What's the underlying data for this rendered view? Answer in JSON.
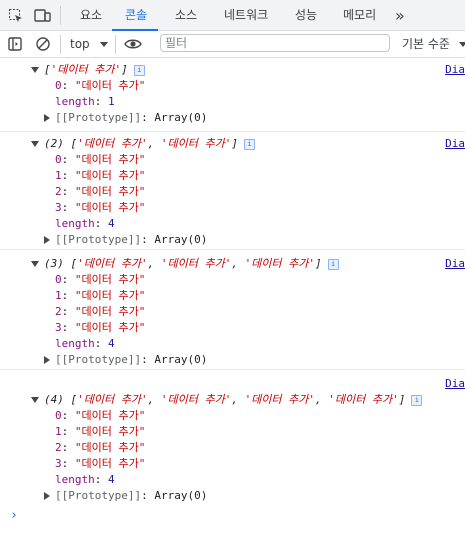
{
  "tabs": [
    {
      "label": "요소"
    },
    {
      "label": "콘솔"
    },
    {
      "label": "소스"
    },
    {
      "label": "네트워크"
    },
    {
      "label": "성능"
    },
    {
      "label": "메모리"
    }
  ],
  "more_tabs": "»",
  "toolbar": {
    "context": "top",
    "filter_placeholder": "필터",
    "levels": "기본 수준"
  },
  "console": {
    "source_link": "Dia",
    "prototype_label": "[[Prototype]]",
    "prototype_value": "Array(0)",
    "length_key": "length",
    "groups": [
      {
        "summary_count": "",
        "summary_items": [
          "'데이터 추가'"
        ],
        "items": [
          "\"데이터 추가\""
        ],
        "length": "1"
      },
      {
        "summary_count": "(2)",
        "summary_items": [
          "'데이터 추가'",
          "'데이터 추가'"
        ],
        "items": [
          "\"데이터 추가\"",
          "\"데이터 추가\"",
          "\"데이터 추가\"",
          "\"데이터 추가\""
        ],
        "length": "4"
      },
      {
        "summary_count": "(3)",
        "summary_items": [
          "'데이터 추가'",
          "'데이터 추가'",
          "'데이터 추가'"
        ],
        "items": [
          "\"데이터 추가\"",
          "\"데이터 추가\"",
          "\"데이터 추가\"",
          "\"데이터 추가\""
        ],
        "length": "4"
      },
      {
        "summary_count": "(4)",
        "summary_items": [
          "'데이터 추가'",
          "'데이터 추가'",
          "'데이터 추가'",
          "'데이터 추가'"
        ],
        "items": [
          "\"데이터 추가\"",
          "\"데이터 추가\"",
          "\"데이터 추가\"",
          "\"데이터 추가\""
        ],
        "length": "4"
      }
    ],
    "prompt_symbol": "›"
  }
}
